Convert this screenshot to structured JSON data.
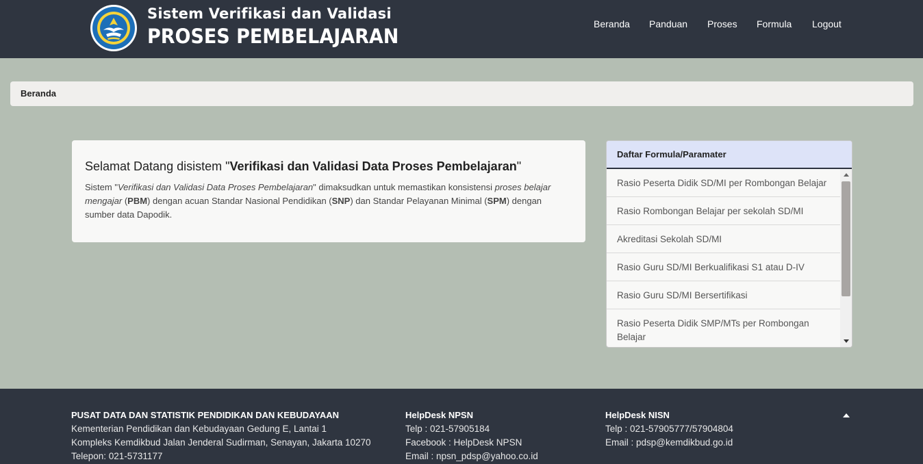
{
  "header": {
    "title_line1": "Sistem Verifikasi dan Validasi",
    "title_line2": "PROSES PEMBELAJARAN",
    "logo_text": "TUT WURI HANDAYANI",
    "nav": [
      "Beranda",
      "Panduan",
      "Proses",
      "Formula",
      "Logout"
    ]
  },
  "breadcrumb": {
    "current": "Beranda"
  },
  "welcome": {
    "heading_prefix": "Selamat Datang disistem \"",
    "heading_bold": "Verifikasi dan Validasi Data Proses Pembelajaran",
    "heading_suffix": "\"",
    "p_sistem": "Sistem \"",
    "p_title_italic": "Verifikasi dan Validasi Data Proses Pembelajaran",
    "p_mid": "\" dimaksudkan untuk memastikan konsistensi ",
    "p_pbm_italic": "proses belajar mengajar",
    "p_open1": " (",
    "p_pbm": "PBM",
    "p_snp_text": ") dengan acuan Standar Nasional Pendidikan (",
    "p_snp": "SNP",
    "p_spm_text": ") dan Standar Pelayanan Minimal (",
    "p_spm": "SPM",
    "p_end": ") dengan sumber data Dapodik."
  },
  "formula_panel": {
    "title": "Daftar Formula/Paramater",
    "items": [
      "Rasio Peserta Didik SD/MI per Rombongan Belajar",
      "Rasio Rombongan Belajar per sekolah SD/MI",
      "Akreditasi Sekolah SD/MI",
      "Rasio Guru SD/MI Berkualifikasi S1 atau D-IV",
      "Rasio Guru SD/MI Bersertifikasi",
      "Rasio Peserta Didik SMP/MTs per Rombongan Belajar"
    ]
  },
  "footer": {
    "col1": {
      "title": "PUSAT DATA DAN STATISTIK PENDIDIKAN DAN KEBUDAYAAN",
      "line1": "Kementerian Pendidikan dan Kebudayaan Gedung E, Lantai 1",
      "line2": "Kompleks Kemdikbud Jalan Jenderal Sudirman, Senayan, Jakarta 10270",
      "line3": "Telepon: 021-5731177"
    },
    "col2": {
      "title": "HelpDesk NPSN",
      "line1": "Telp : 021-57905184",
      "line2": "Facebook : HelpDesk NPSN",
      "line3": "Email : npsn_pdsp@yahoo.co.id"
    },
    "col3": {
      "title": "HelpDesk NISN",
      "line1": "Telp : 021-57905777/57904804",
      "line2": "Email : pdsp@kemdikbud.go.id"
    }
  },
  "colors": {
    "header_bg": "#2f3540",
    "page_bg": "#b4beb3",
    "panel_head_bg": "#dde3f8",
    "logo_blue": "#1d6fb8"
  }
}
